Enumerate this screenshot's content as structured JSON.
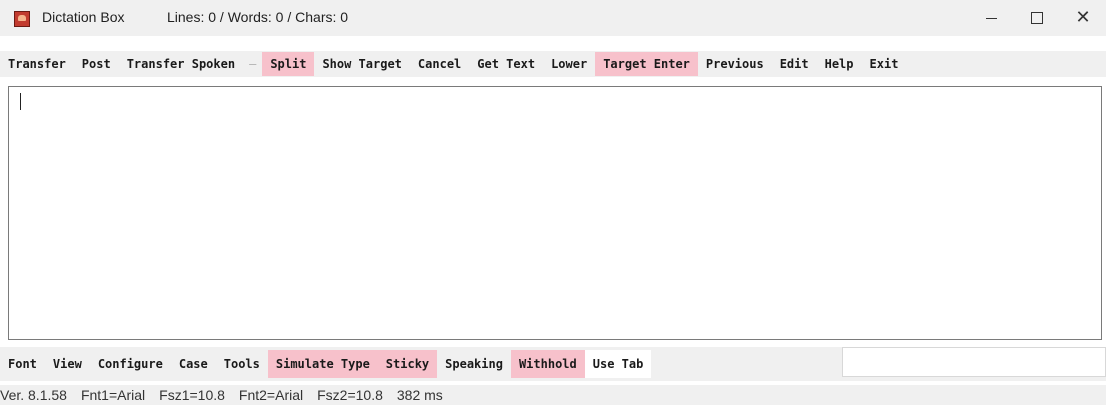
{
  "window": {
    "title": "Dictation Box",
    "stats": "Lines: 0 / Words: 0 / Chars: 0",
    "minimize_glyph": "—",
    "maximize_glyph": "☐",
    "close_glyph": "✕"
  },
  "top_toolbar": [
    {
      "label": "Transfer",
      "style": "normal"
    },
    {
      "label": "Post",
      "style": "normal"
    },
    {
      "label": "Transfer Spoken",
      "style": "normal"
    },
    {
      "label": "—",
      "style": "separator"
    },
    {
      "label": "Split",
      "style": "pink"
    },
    {
      "label": "Show Target",
      "style": "normal"
    },
    {
      "label": "Cancel",
      "style": "normal"
    },
    {
      "label": "Get Text",
      "style": "normal"
    },
    {
      "label": "Lower",
      "style": "normal"
    },
    {
      "label": "Target Enter",
      "style": "pink"
    },
    {
      "label": "Previous",
      "style": "normal"
    },
    {
      "label": "Edit",
      "style": "normal"
    },
    {
      "label": "Help",
      "style": "normal"
    },
    {
      "label": "Exit",
      "style": "normal"
    }
  ],
  "editor": {
    "value": ""
  },
  "bottom_toolbar": [
    {
      "label": "Font",
      "style": "normal"
    },
    {
      "label": "View",
      "style": "normal"
    },
    {
      "label": "Configure",
      "style": "normal"
    },
    {
      "label": "Case",
      "style": "normal"
    },
    {
      "label": "Tools",
      "style": "normal"
    },
    {
      "label": "Simulate Type",
      "style": "pink"
    },
    {
      "label": "Sticky",
      "style": "pink"
    },
    {
      "label": "Speaking",
      "style": "normal"
    },
    {
      "label": "Withhold",
      "style": "pink"
    },
    {
      "label": "Use Tab",
      "style": "white"
    }
  ],
  "side_input": {
    "value": ""
  },
  "status": {
    "version": "Ver. 8.1.58",
    "fnt1": "Fnt1=Arial",
    "fsz1": "Fsz1=10.8",
    "fnt2": "Fnt2=Arial",
    "fsz2": "Fsz2=10.8",
    "timing": "382 ms"
  },
  "colors": {
    "toggle_on": "#f7c1cb",
    "chrome": "#f0f0f0"
  }
}
